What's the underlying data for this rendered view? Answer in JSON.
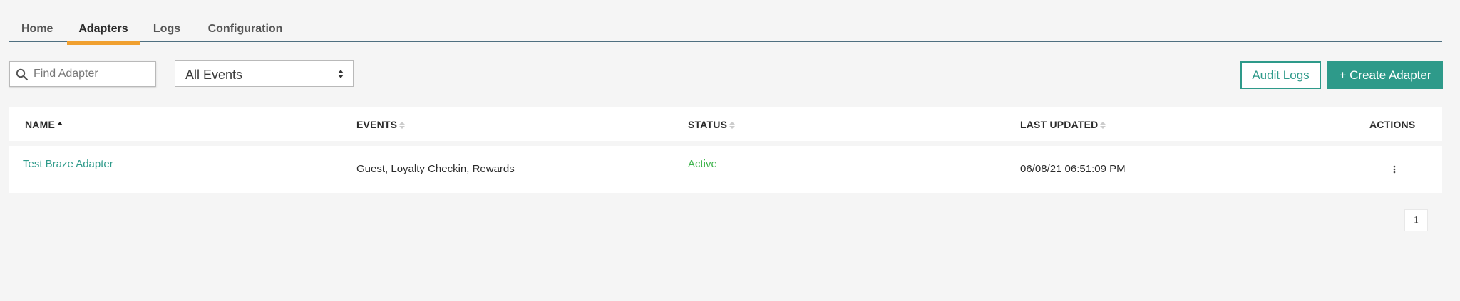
{
  "tabs": [
    {
      "label": "Home"
    },
    {
      "label": "Adapters"
    },
    {
      "label": "Logs"
    },
    {
      "label": "Configuration"
    }
  ],
  "active_tab": "Adapters",
  "search": {
    "placeholder": "Find Adapter",
    "value": ""
  },
  "events_filter": {
    "selected": "All Events"
  },
  "buttons": {
    "audit_logs": "Audit Logs",
    "create_adapter": "+ Create Adapter"
  },
  "table": {
    "columns": [
      {
        "label": "NAME",
        "sort": "ascending"
      },
      {
        "label": "EVENTS",
        "sort": "none"
      },
      {
        "label": "STATUS",
        "sort": "none"
      },
      {
        "label": "LAST UPDATED",
        "sort": "none"
      },
      {
        "label": "ACTIONS"
      }
    ],
    "rows": [
      {
        "name": "Test Braze Adapter",
        "events": "Guest, Loyalty Checkin, Rewards",
        "status": "Active",
        "last_updated": "06/08/21 06:51:09 PM"
      }
    ]
  },
  "pagination": {
    "current_page": "1",
    "info_text": ".."
  },
  "colors": {
    "accent": "#2e9a8a",
    "tab_underline": "#f0a030",
    "tab_border": "#4f6f80",
    "status_active": "#3cb34a"
  },
  "icons": [
    "search-icon",
    "select-arrows-icon",
    "sort-asc-icon",
    "sort-both-icon",
    "kebab-menu-icon"
  ]
}
